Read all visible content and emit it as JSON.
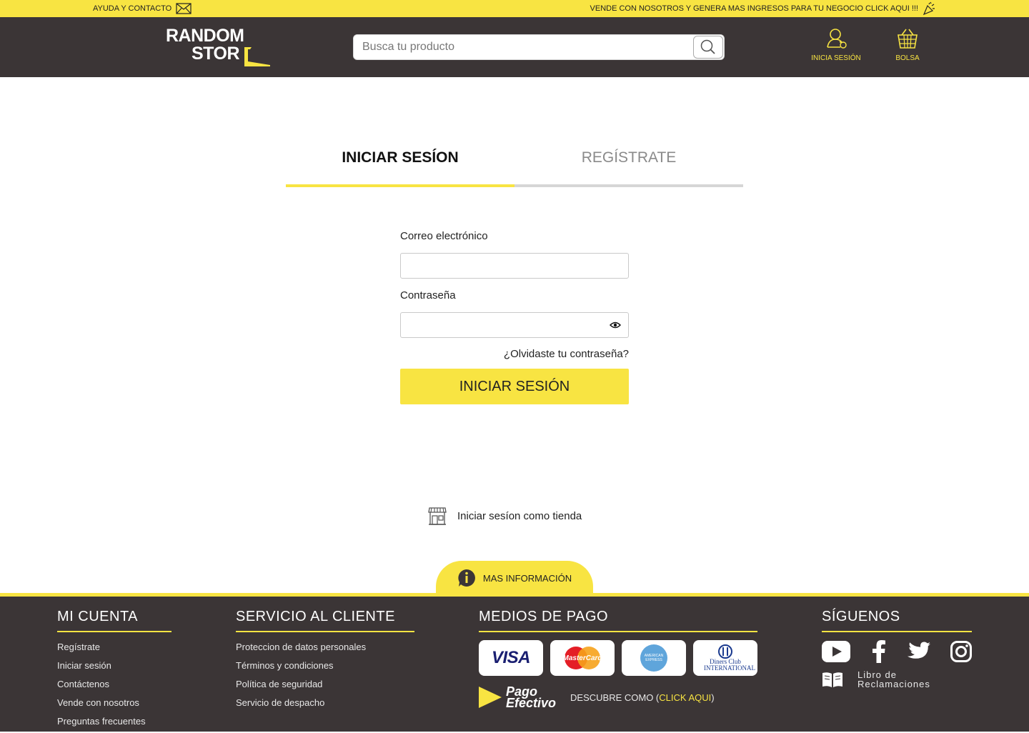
{
  "topbar": {
    "help_label": "AYUDA Y CONTACTO",
    "promo_label": "VENDE CON NOSOTROS Y  GENERA MAS INGRESOS PARA TU NEGOCIO CLICK AQUI !!!"
  },
  "header": {
    "logo_line1": "RANDOM",
    "logo_line2": "STOR",
    "search_placeholder": "Busca tu producto",
    "login_label": "INICIA SESIÓN",
    "bag_label": "BOLSA"
  },
  "tabs": [
    {
      "label": "INICIAR SESÍON"
    },
    {
      "label": "REGÍSTRATE"
    }
  ],
  "form": {
    "email_label": "Correo electrónico",
    "email_value": "",
    "password_label": "Contraseña",
    "password_value": "",
    "forgot_label": "¿Olvidaste tu contraseña?",
    "submit_label": "INICIAR SESIÓN"
  },
  "store_login_label": "Iniciar sesíon como tienda",
  "more_info_label": "MAS INFORMACIÓN",
  "footer": {
    "cuenta": {
      "title": "MI CUENTA",
      "links": [
        "Regístrate",
        "Iniciar sesión",
        "Contáctenos",
        "Vende con nosotros",
        "Preguntas frecuentes"
      ]
    },
    "servicio": {
      "title": "SERVICIO AL CLIENTE",
      "links": [
        "Proteccion de datos personales",
        "Términos y condiciones",
        "Política de seguridad",
        "Servicio de despacho"
      ]
    },
    "pago": {
      "title": "MEDIOS DE PAGO",
      "cards": [
        "VISA",
        "MasterCard",
        "AMERICAN EXPRESS",
        "Diners Club INTERNATIONAL"
      ],
      "pago_line1": "Pago",
      "pago_line2": "Efectivo",
      "discover_prefix": "DESCUBRE COMO (",
      "discover_link": "CLICK AQUI",
      "discover_suffix": ")"
    },
    "siguenos": {
      "title": "SÍGUENOS",
      "networks": [
        "youtube-icon",
        "facebook-icon",
        "twitter-icon",
        "instagram-icon"
      ],
      "libro_line1": "Libro de",
      "libro_line2": "Reclamaciones"
    }
  },
  "colors": {
    "accent": "#f8e442",
    "dark": "#3b3536"
  }
}
